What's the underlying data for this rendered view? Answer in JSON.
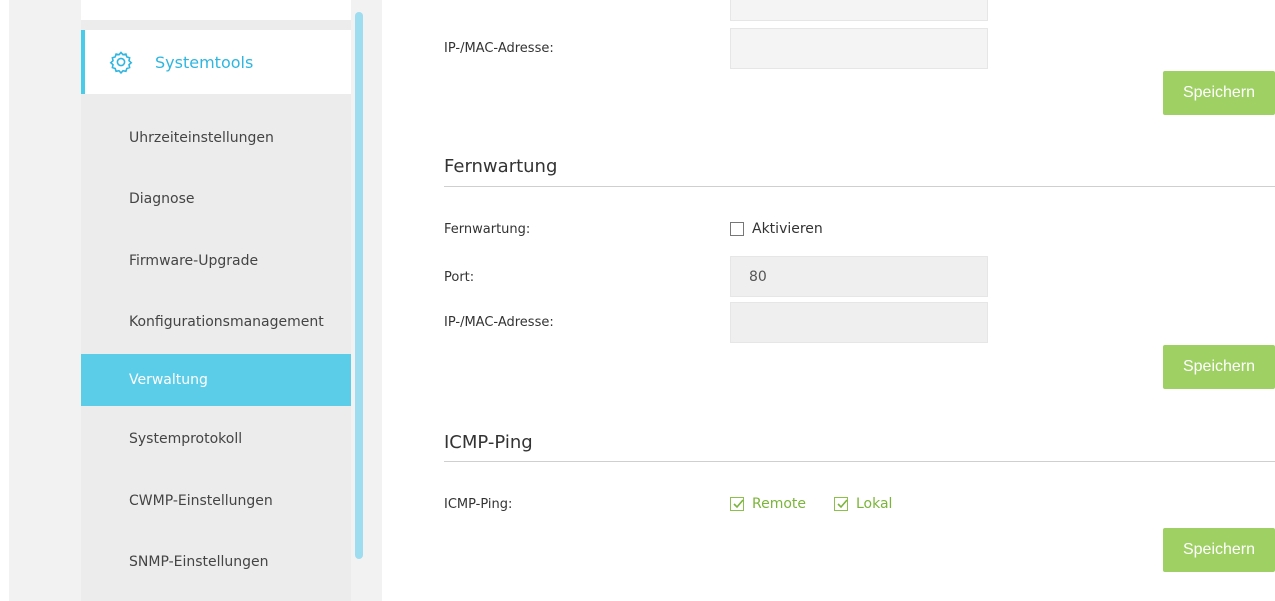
{
  "sidebar": {
    "header": {
      "label": "Systemtools",
      "icon": "gear-icon"
    },
    "items": [
      {
        "label": "Uhrzeiteinstellungen",
        "active": false
      },
      {
        "label": "Diagnose",
        "active": false
      },
      {
        "label": "Firmware-Upgrade",
        "active": false
      },
      {
        "label": "Konfigurationsmanagement",
        "active": false
      },
      {
        "label": "Verwaltung",
        "active": true
      },
      {
        "label": "Systemprotokoll",
        "active": false
      },
      {
        "label": "CWMP-Einstellungen",
        "active": false
      },
      {
        "label": "SNMP-Einstellungen",
        "active": false
      }
    ],
    "accent_color": "#5ccde9"
  },
  "top_section": {
    "ip_mac_label": "IP-/MAC-Adresse:",
    "ip_mac_value": "",
    "save_label": "Speichern"
  },
  "fernwartung": {
    "title": "Fernwartung",
    "enable_label": "Fernwartung:",
    "enable_checkbox_label": "Aktivieren",
    "enable_checked": false,
    "port_label": "Port:",
    "port_value": "80",
    "ip_mac_label": "IP-/MAC-Adresse:",
    "ip_mac_value": "",
    "save_label": "Speichern"
  },
  "icmp_ping": {
    "title": "ICMP-Ping",
    "label": "ICMP-Ping:",
    "remote_label": "Remote",
    "remote_checked": true,
    "local_label": "Lokal",
    "local_checked": true,
    "save_label": "Speichern"
  },
  "button_color": "#9ed064"
}
